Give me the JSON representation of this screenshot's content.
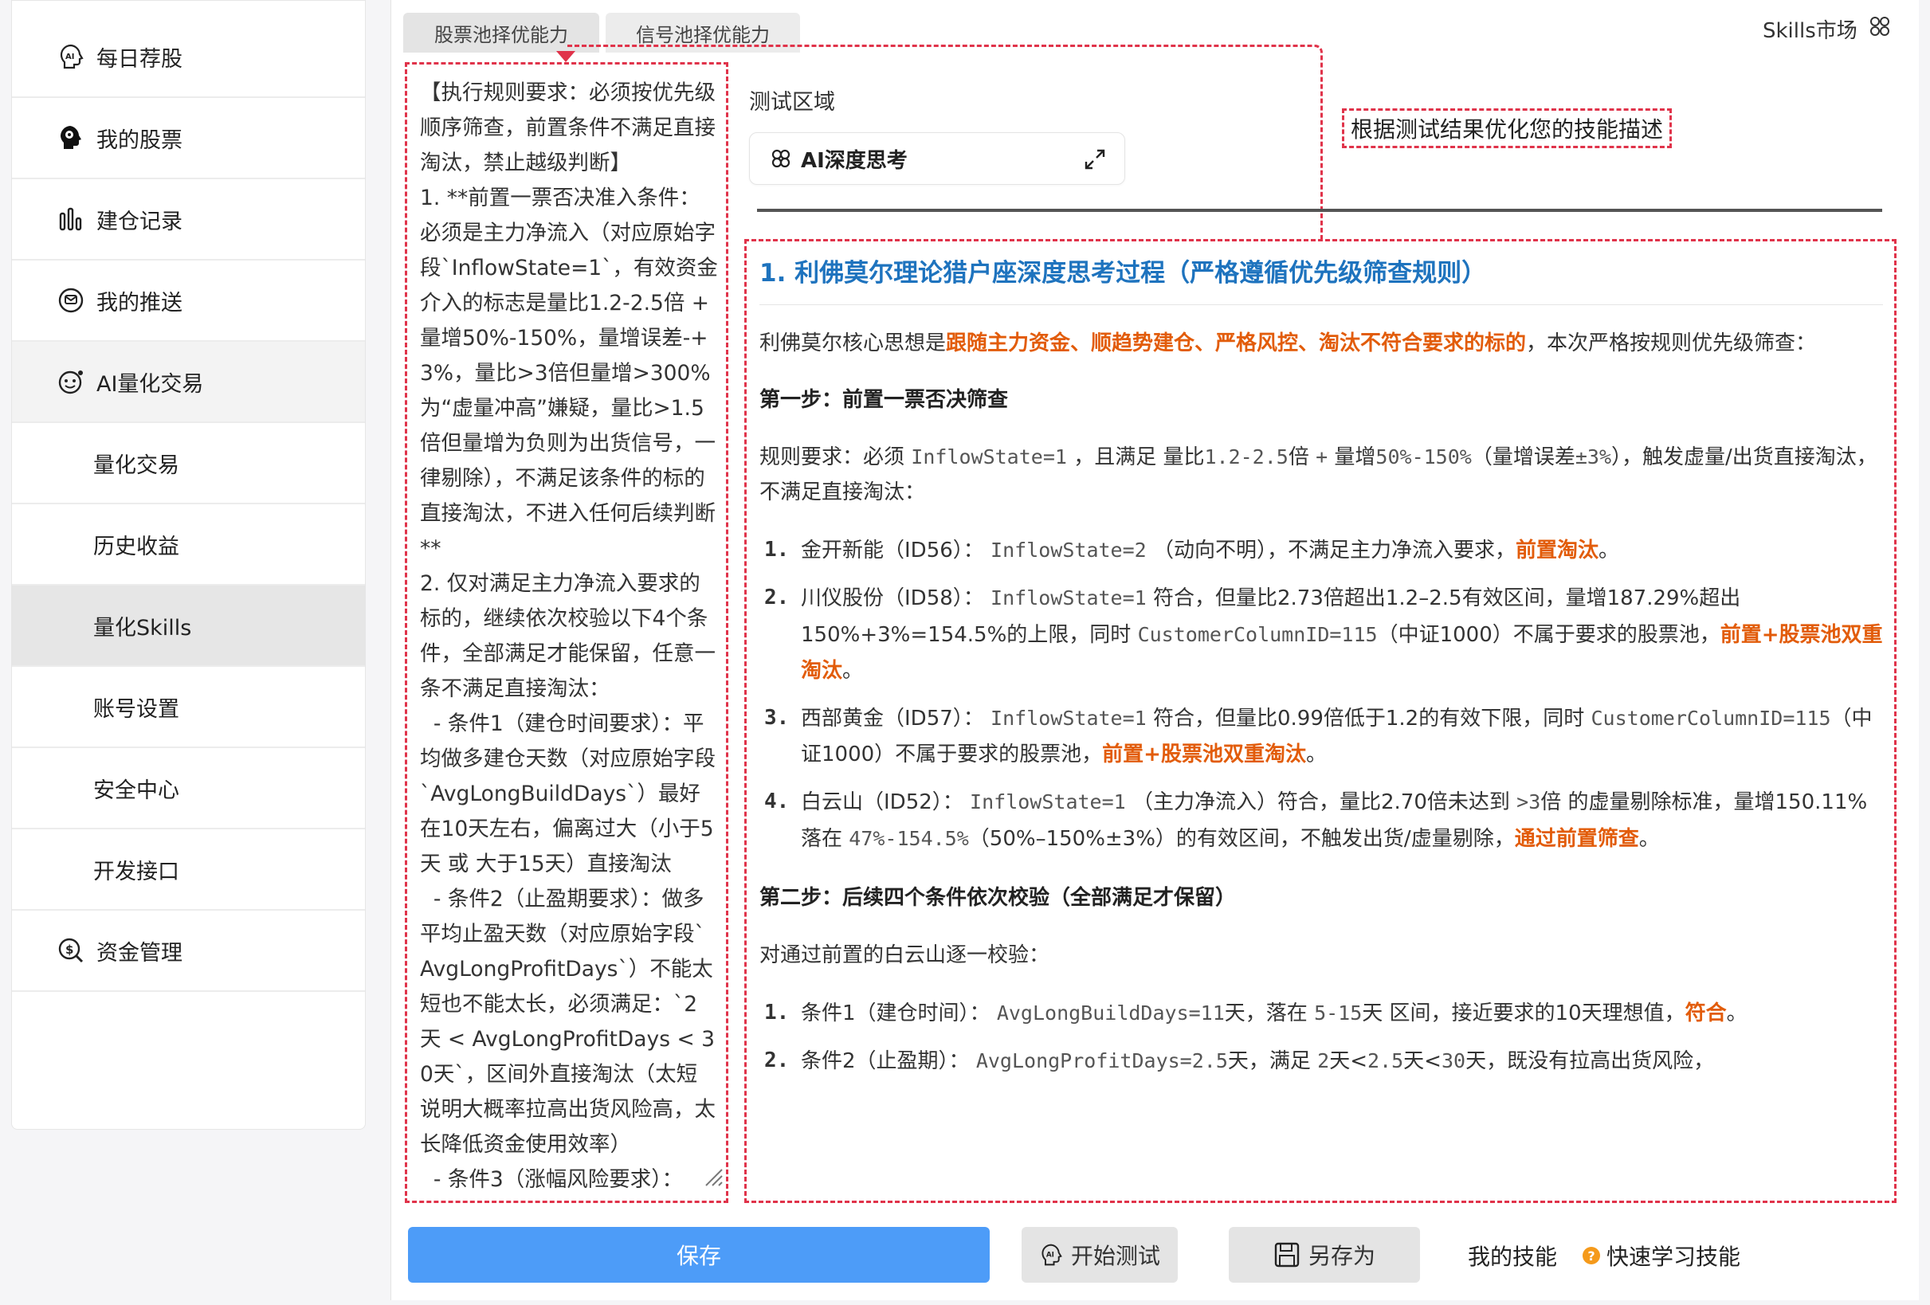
{
  "sidebar": {
    "items": [
      {
        "label": "每日荐股",
        "icon": "ai-head-icon"
      },
      {
        "label": "我的股票",
        "icon": "brain-icon"
      },
      {
        "label": "建仓记录",
        "icon": "bar-chart-icon"
      },
      {
        "label": "我的推送",
        "icon": "message-icon"
      },
      {
        "label": "AI量化交易",
        "icon": "robot-face-icon"
      },
      {
        "label": "量化交易"
      },
      {
        "label": "历史收益"
      },
      {
        "label": "量化Skills"
      },
      {
        "label": "账号设置"
      },
      {
        "label": "安全中心"
      },
      {
        "label": "开发接口"
      },
      {
        "label": "资金管理",
        "icon": "money-search-icon"
      }
    ]
  },
  "tabs": [
    "股票池择优能力",
    "信号池择优能力"
  ],
  "skills_market": "Skills市场",
  "rules_text": "【执行规则要求：必须按优先级顺序筛查，前置条件不满足直接淘汰，禁止越级判断】\n1. **前置一票否决准入条件：必须是主力净流入（对应原始字段`InflowState=1`，有效资金介入的标志是量比1.2-2.5倍 + 量增50%-150%，量增误差-+3%，量比>3倍但量增>300%为“虚量冲高”嫌疑，量比>1.5倍但量增为负则为出货信号，一律剔除），不满足该条件的标的直接淘汰，不进入任何后续判断**\n2. 仅对满足主力净流入要求的标的，继续依次校验以下4个条件，全部满足才能保留，任意一条不满足直接淘汰：\n  - 条件1（建仓时间要求）：平均做多建仓天数（对应原始字段`AvgLongBuildDays`）最好在10天左右，偏离过大（小于5天 或 大于15天）直接淘汰\n  - 条件2（止盈期要求）：做多平均止盈天数（对应原始字段`AvgLongProfitDays`）不能太短也不能太长，必须满足：`2天 < AvgLongProfitDays < 30天`，区间外直接淘汰（太短说明大概率拉高出货风险高，太长降低资金使用效率）\n  - 条件3（涨幅风险要求）：",
  "test_area": {
    "title": "测试区域",
    "ai_chip": "AI深度思考",
    "optimize_hint": "根据测试结果优化您的技能描述"
  },
  "output": {
    "h1": "1. 利佛莫尔理论猎户座深度思考过程（严格遵循优先级筛查规则）",
    "intro_pre": "利佛莫尔核心思想是",
    "intro_hl": "跟随主力资金、顺趋势建仓、严格风控、淘汰不符合要求的标的",
    "intro_post": "，本次严格按规则优先级筛查：",
    "step1": "第一步：前置一票否决筛查",
    "rule_a": "规则要求：必须 ",
    "rule_code1": "InflowState=1",
    "rule_b": " ，且满足 量比",
    "rule_code2": "1.2-2.5",
    "rule_c": "倍 ",
    "rule_code3": "+",
    "rule_d": " 量增",
    "rule_code4": "50%-150%",
    "rule_e": "（量增误差",
    "rule_code5": "±3%",
    "rule_f": "），触发虚量/出货直接淘汰，不满足直接淘汰：",
    "list1": [
      {
        "num": "1.",
        "a": "金开新能（ID56）：",
        "code": "InflowState=2",
        "b": "（动向不明），不满足主力净流入要求，",
        "hl": "前置淘汰",
        "c": "。"
      },
      {
        "num": "2.",
        "a": "川仪股份（ID58）：",
        "code": "InflowState=1",
        "b": "符合，但量比2.73倍超出1.2–2.5有效区间，量增187.29%超出150%+3%=154.5%的上限，同时 ",
        "code2": "CustomerColumnID=115",
        "b2": "（中证1000）不属于要求的股票池，",
        "hl": "前置+股票池双重淘汰",
        "c": "。"
      },
      {
        "num": "3.",
        "a": "西部黄金（ID57）：",
        "code": "InflowState=1",
        "b": "符合，但量比0.99倍低于1.2的有效下限，同时 ",
        "code2": "CustomerColumnID=115",
        "b2": "（中证1000）不属于要求的股票池，",
        "hl": "前置+股票池双重淘汰",
        "c": "。"
      },
      {
        "num": "4.",
        "a": "白云山（ID52）：",
        "code": "InflowState=1",
        "b": "（主力净流入）符合，量比2.70倍未达到 ",
        "code2": ">3",
        "b2": "倍 的虚量剔除标准，量增150.11%落在 ",
        "code3": "47%-154.5%",
        "b3": "（50%–150%±3%）的有效区间，不触发出货/虚量剔除，",
        "hl": "通过前置筛查",
        "c": "。"
      }
    ],
    "step2": "第二步：后续四个条件依次校验（全部满足才保留）",
    "step2_intro": "对通过前置的白云山逐一校验：",
    "list2": [
      {
        "num": "1.",
        "a": "条件1（建仓时间）：",
        "code": "AvgLongBuildDays=11",
        "b": "天，落在 ",
        "code2": "5-15",
        "b2": "天 区间，接近要求的10天理想值，",
        "hl": "符合",
        "c": "。"
      },
      {
        "num": "2.",
        "a": "条件2（止盈期）：",
        "code": "AvgLongProfitDays=2.5",
        "b": "天，满足 ",
        "code2": "2",
        "b2": "天<",
        "code3": "2.5",
        "b3": "天<",
        "code4": "30",
        "b4": "天，既没有拉高出货风险，"
      }
    ]
  },
  "bottom": {
    "save": "保存",
    "start_test": "开始测试",
    "save_as": "另存为",
    "my_skills": "我的技能",
    "quick_learn": "快速学习技能",
    "help_mark": "?"
  }
}
